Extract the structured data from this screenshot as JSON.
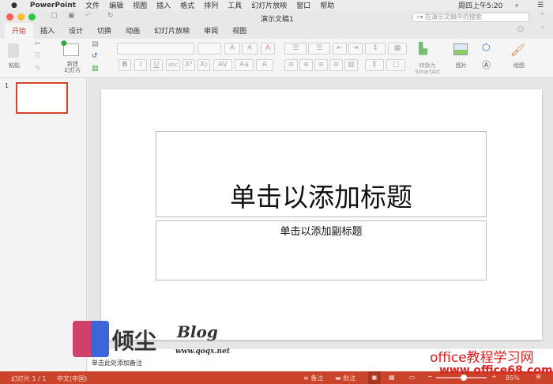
{
  "menubar": {
    "app": "PowerPoint",
    "items": [
      "文件",
      "编辑",
      "视图",
      "插入",
      "格式",
      "排列",
      "工具",
      "幻灯片放映",
      "窗口",
      "帮助"
    ],
    "clock": "周四上午5:20"
  },
  "titlebar": {
    "title": "演示文稿1",
    "search_placeholder": "在演示文稿中的搜索"
  },
  "tabs": [
    "开始",
    "插入",
    "设计",
    "切换",
    "动画",
    "幻灯片放映",
    "审阅",
    "视图"
  ],
  "ribbon": {
    "paste": "粘贴",
    "new_slide": "新建\n幻灯片",
    "convert": "转换为\nSmartArt",
    "picture": "图片",
    "draw": "绘图",
    "bold": "B",
    "italic": "I",
    "underline": "U",
    "strike": "abc",
    "sup": "X²",
    "sub": "X₂"
  },
  "thumbs": {
    "number": "1"
  },
  "slide": {
    "title": "单击以添加标题",
    "subtitle": "单击以添加副标题"
  },
  "notes": {
    "placeholder": "单击此处添加备注"
  },
  "status": {
    "slide_count": "幻灯片 1 / 1",
    "language": "中文(中国)",
    "notes": "备注",
    "comments": "批注",
    "zoom": "85%",
    "zoom_fraction": 0.55
  },
  "watermark": {
    "logo": "倾尘",
    "blog": "Blog",
    "url": "www.qoqx.net",
    "site": "office教程学习网",
    "site_url": "www.office68.com"
  },
  "colors": {
    "accent": "#c9442a"
  }
}
